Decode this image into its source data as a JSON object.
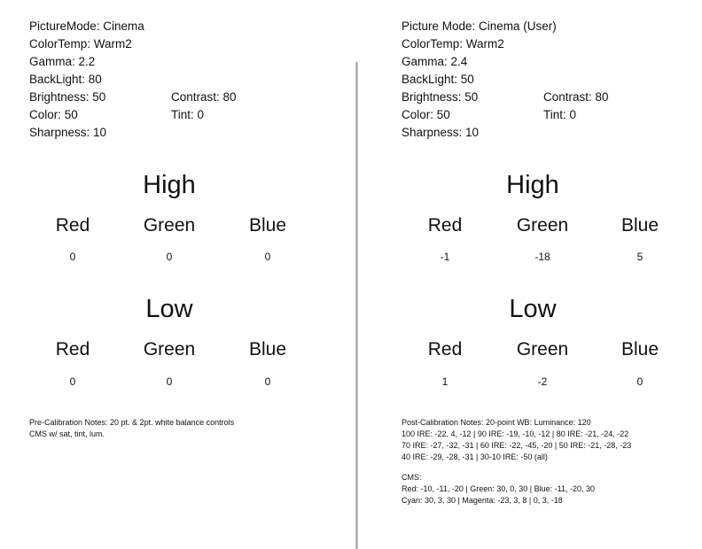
{
  "left": {
    "settings": {
      "picture_mode": "PictureMode: Cinema",
      "color_temp": "ColorTemp: Warm2",
      "gamma": "Gamma: 2.2",
      "backlight": "BackLight: 80",
      "brightness": "Brightness: 50",
      "contrast": "Contrast: 80",
      "color": "Color: 50",
      "tint": "Tint: 0",
      "sharpness": "Sharpness: 10"
    },
    "high": {
      "title": "High",
      "channels": [
        {
          "label": "Red",
          "value": "0"
        },
        {
          "label": "Green",
          "value": "0"
        },
        {
          "label": "Blue",
          "value": "0"
        }
      ]
    },
    "low": {
      "title": "Low",
      "channels": [
        {
          "label": "Red",
          "value": "0"
        },
        {
          "label": "Green",
          "value": "0"
        },
        {
          "label": "Blue",
          "value": "0"
        }
      ]
    },
    "notes": [
      "Pre-Calibration Notes: 20 pt. & 2pt. white balance controls",
      "CMS w/ sat, tint, lum."
    ]
  },
  "right": {
    "settings": {
      "picture_mode": "Picture Mode: Cinema (User)",
      "color_temp": "ColorTemp: Warm2",
      "gamma": "Gamma: 2.4",
      "backlight": "BackLight: 50",
      "brightness": "Brightness: 50",
      "contrast": "Contrast: 80",
      "color": "Color: 50",
      "tint": "Tint: 0",
      "sharpness": "Sharpness: 10"
    },
    "high": {
      "title": "High",
      "channels": [
        {
          "label": "Red",
          "value": "-1"
        },
        {
          "label": "Green",
          "value": "-18"
        },
        {
          "label": "Blue",
          "value": "5"
        }
      ]
    },
    "low": {
      "title": "Low",
      "channels": [
        {
          "label": "Red",
          "value": "1"
        },
        {
          "label": "Green",
          "value": "-2"
        },
        {
          "label": "Blue",
          "value": "0"
        }
      ]
    },
    "notes": [
      "Post-Calibration Notes: 20-point WB: Luminance: 120",
      "100 IRE: -22, 4, -12 | 90 IRE: -19, -10, -12 | 80 IRE: -21, -24, -22",
      "70 IRE: -27, -32, -31 | 60 IRE: -22, -45, -20 | 50 IRE: -21, -28, -23",
      "40 IRE: -29, -28, -31 | 30-10 IRE: -50 (all)"
    ],
    "cms": {
      "title": "CMS:",
      "lines": [
        "Red: -10, -11, -20 | Green: 30, 0, 30 | Blue: -11, -20, 30",
        "Cyan: 30, 3, 30 | Magenta: -23, 3, 8 | 0, 3, -18"
      ]
    }
  }
}
